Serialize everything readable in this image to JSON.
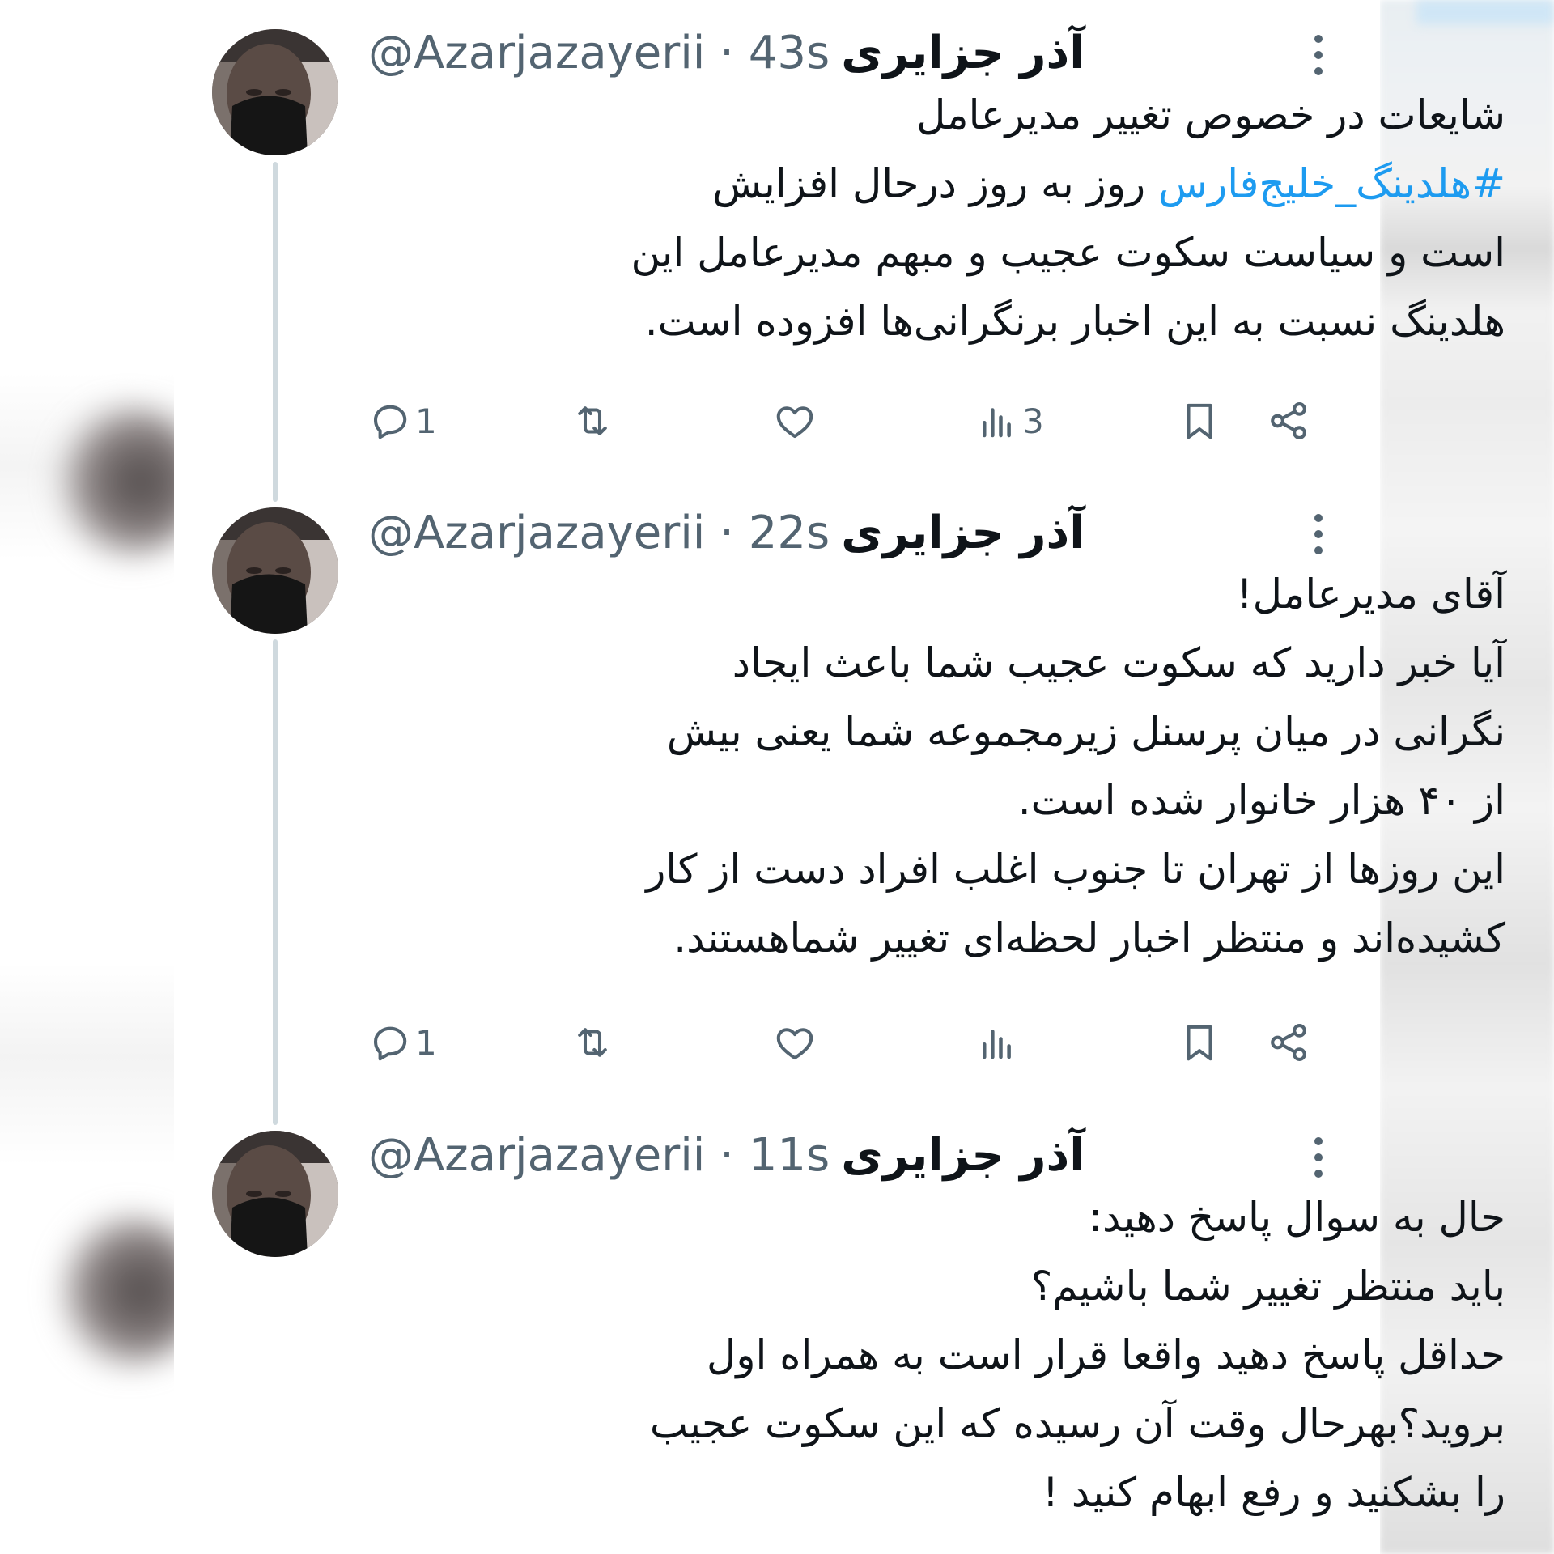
{
  "tweets": [
    {
      "author_name": "آذر جزایری",
      "meta": "@Azarjazayerii · 43s",
      "text_lines": [
        "شایعات در خصوص تغییر مدیرعامل",
        "روز به روز درحال افزایش",
        "است و سیاست سکوت عجیب و مبهم مدیرعامل این",
        "هلدینگ نسبت به این اخبار برنگرانی‌ها افزوده است."
      ],
      "hashtag": "#هلدینگ_خلیج‌فارس",
      "reply_count": "1",
      "views_count": "3"
    },
    {
      "author_name": "آذر جزایری",
      "meta": "@Azarjazayerii · 22s",
      "text_lines": [
        "آقای مدیرعامل!",
        "آیا خبر دارید که سکوت عجیب شما باعث ایجاد",
        "نگرانی در میان پرسنل زیرمجموعه شما یعنی بیش",
        "از ۴۰ هزار خانوار شده است.",
        "این روزها از تهران تا جنوب اغلب افراد دست از کار",
        "کشیده‌اند و منتظر اخبار لحظه‌ای تغییر شماهستند."
      ],
      "reply_count": "1",
      "views_count": ""
    },
    {
      "author_name": "آذر جزایری",
      "meta": "@Azarjazayerii · 11s",
      "text_lines": [
        "حال به سوال پاسخ دهید:",
        "باید منتظر تغییر شما باشیم؟",
        "حداقل پاسخ دهید واقعا قرار است به همراه اول",
        "بروید؟بهرحال وقت آن رسیده که این سکوت عجیب",
        "را بشکنید و رفع ابهام کنید !"
      ]
    }
  ],
  "icons": [
    "reply-icon",
    "retweet-icon",
    "like-icon",
    "views-icon",
    "bookmark-icon",
    "share-icon",
    "more-icon"
  ],
  "colors": {
    "accent": "#1d9bf0",
    "text": "#0f1419",
    "secondary": "#536471",
    "thread_line": "#cfd9de"
  }
}
